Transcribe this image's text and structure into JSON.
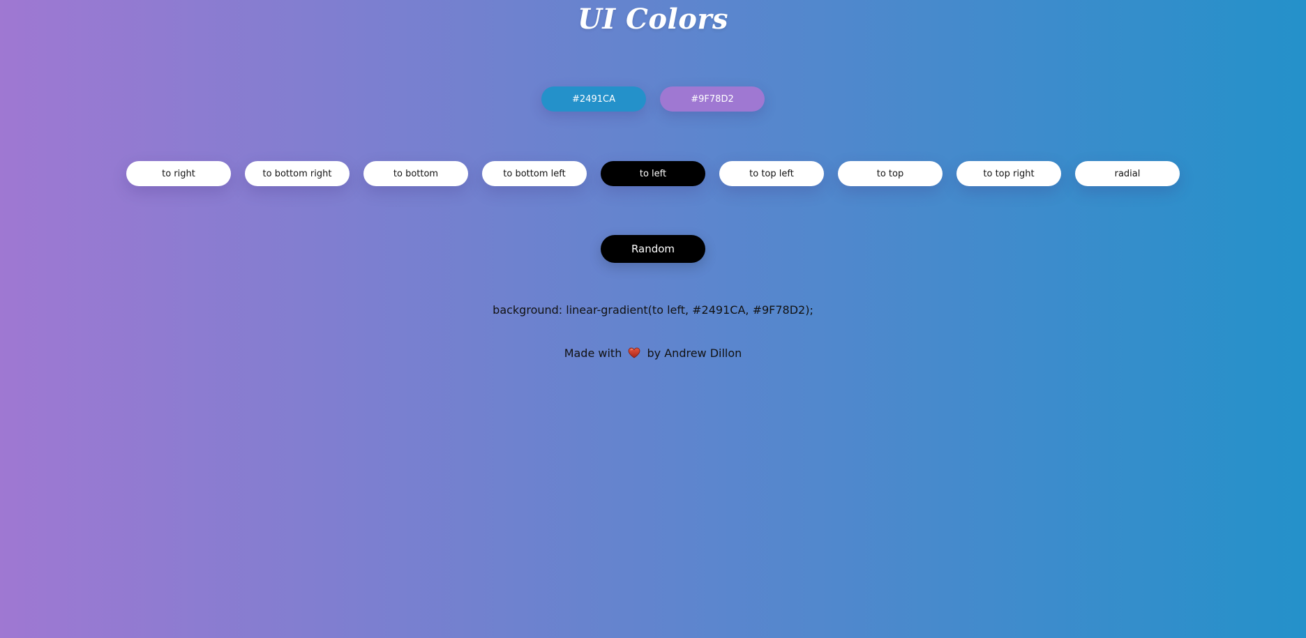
{
  "header": {
    "title": "UI Colors"
  },
  "colors": [
    {
      "label": "#2491CA",
      "hex": "#2491CA"
    },
    {
      "label": "#9F78D2",
      "hex": "#9F78D2"
    }
  ],
  "directions": {
    "items": [
      {
        "label": "to right"
      },
      {
        "label": "to bottom right"
      },
      {
        "label": "to bottom"
      },
      {
        "label": "to bottom left"
      },
      {
        "label": "to left",
        "selected": true
      },
      {
        "label": "to top left"
      },
      {
        "label": "to top"
      },
      {
        "label": "to top right"
      },
      {
        "label": "radial"
      }
    ],
    "selected": "to left"
  },
  "random_button": {
    "label": "Random"
  },
  "css_output": "background: linear-gradient(to left, #2491CA, #9F78D2);",
  "footer": {
    "made_with": "Made with",
    "by": "by Andrew Dillon",
    "icon": "heart-icon",
    "icon_color": "#C0392B"
  }
}
